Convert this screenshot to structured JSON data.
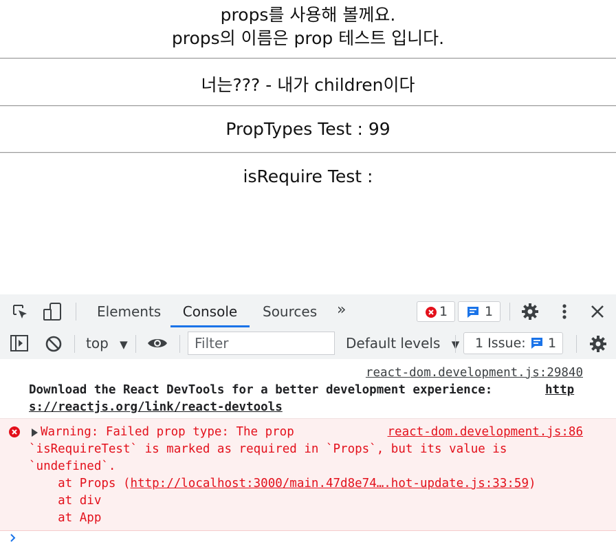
{
  "app": {
    "line1": "props를 사용해 볼께요.",
    "line2": "props의 이름은 prop 테스트 입니다.",
    "children_line": "너는??? - 내가 children이다",
    "proptypes_line": "PropTypes Test : 99",
    "isrequire_line": "isRequire Test :"
  },
  "devtools": {
    "tabs": [
      "Elements",
      "Console",
      "Sources"
    ],
    "more_tabs": "»",
    "error_count": "1",
    "message_count": "1",
    "context": "top",
    "filter_placeholder": "Filter",
    "levels": "Default levels",
    "issues_label": "1 Issue:",
    "issues_count": "1"
  },
  "console": {
    "info": {
      "source": "react-dom.development.js:29840",
      "text": "Download the React DevTools for a better development experience: ",
      "link_part1": "http",
      "link_part2": "s://reactjs.org/link/react-devtools"
    },
    "error": {
      "source": "react-dom.development.js:86",
      "line1": "Warning: Failed prop type: The prop",
      "line2": "`isRequireTest` is marked as required in `Props`, but its value is",
      "line3": "`undefined`.",
      "stack1_prefix": "    at Props (",
      "stack1_link": "http://localhost:3000/main.47d8e74….hot-update.js:33:59",
      "stack1_suffix": ")",
      "stack2": "    at div",
      "stack3": "    at App"
    }
  },
  "colors": {
    "accent": "#1a73e8",
    "error": "#e3101b",
    "error_bg": "#fdf0f0"
  }
}
